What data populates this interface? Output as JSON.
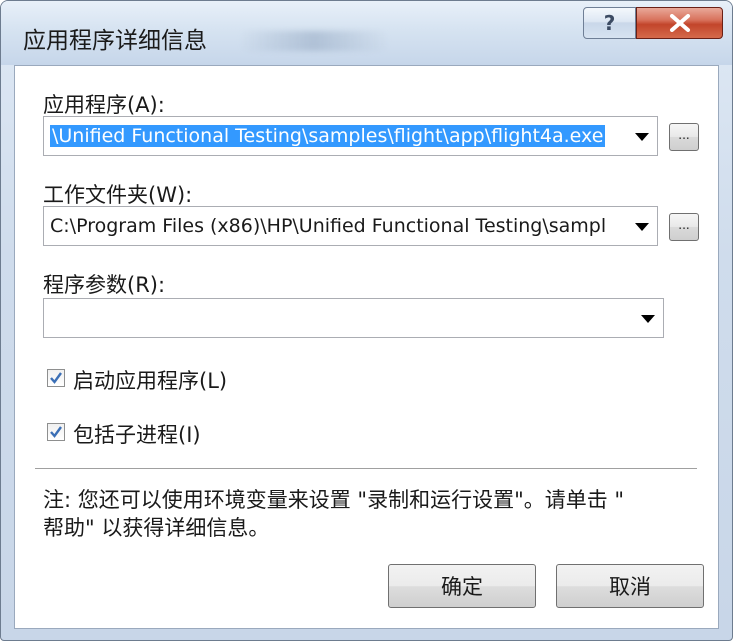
{
  "window": {
    "title": "应用程序详细信息",
    "help_glyph": "?",
    "close_icon": "close-x-icon"
  },
  "application": {
    "label": "应用程序(A):",
    "value": "\\Unified Functional Testing\\samples\\flight\\app\\flight4a.exe",
    "browse_label": "..."
  },
  "working_folder": {
    "label": "工作文件夹(W):",
    "value": "C:\\Program Files (x86)\\HP\\Unified Functional Testing\\sampl",
    "browse_label": "..."
  },
  "arguments": {
    "label": "程序参数(R):",
    "value": ""
  },
  "options": {
    "launch_app": {
      "label": "启动应用程序(L)",
      "checked": true
    },
    "include_children": {
      "label": "包括子进程(I)",
      "checked": true
    }
  },
  "note": {
    "line1": "注: 您还可以使用环境变量来设置 \"录制和运行设置\"。请单击 \"",
    "line2": "帮助\" 以获得详细信息。"
  },
  "buttons": {
    "ok": "确定",
    "cancel": "取消"
  },
  "colors": {
    "selection": "#3399ff",
    "close_button": "#c2452b",
    "title_bar": "#d6e3f1"
  }
}
